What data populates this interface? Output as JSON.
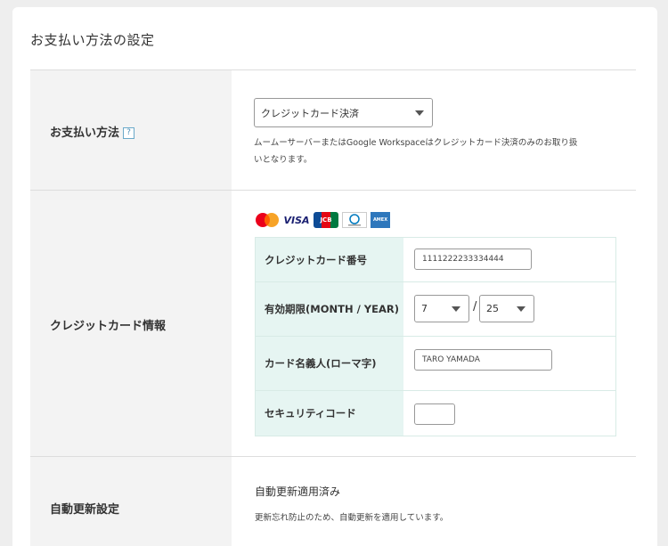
{
  "page": {
    "title": "お支払い方法の設定"
  },
  "payment_method": {
    "label": "お支払い方法",
    "help_icon": "?",
    "selected": "クレジットカード決済",
    "note_line1": "ムームーサーバーまたはGoogle Workspaceはクレジットカード決済のみのお取り扱",
    "note_line2": "いとなります。"
  },
  "credit_card": {
    "label": "クレジットカード情報",
    "brands": [
      "mastercard-logo",
      "visa-logo",
      "jcb-logo",
      "diners-club-logo",
      "amex-logo"
    ],
    "brand_text": {
      "visa": "VISA",
      "jcb": "JCB",
      "amex": "AMEX"
    },
    "fields": {
      "number_label": "クレジットカード番号",
      "number_value": "1111222233334444",
      "expiry_label": "有効期限(MONTH / YEAR)",
      "expiry_month": "7",
      "expiry_separator": "/",
      "expiry_year": "25",
      "holder_label": "カード名義人(ローマ字)",
      "holder_value": "TARO YAMADA",
      "cvc_label": "セキュリティコード",
      "cvc_value": ""
    }
  },
  "auto_renew": {
    "label": "自動更新設定",
    "status": "自動更新適用済み",
    "note": "更新忘れ防止のため、自動更新を適用しています。"
  },
  "colors": {
    "label_bg": "#f3f3f3",
    "card_header_bg": "#e6f5f2",
    "mastercard_red": "#eb001b",
    "mastercard_orange": "#f79e1b",
    "visa_blue": "#1a1f71",
    "amex_blue": "#2e77bc"
  }
}
